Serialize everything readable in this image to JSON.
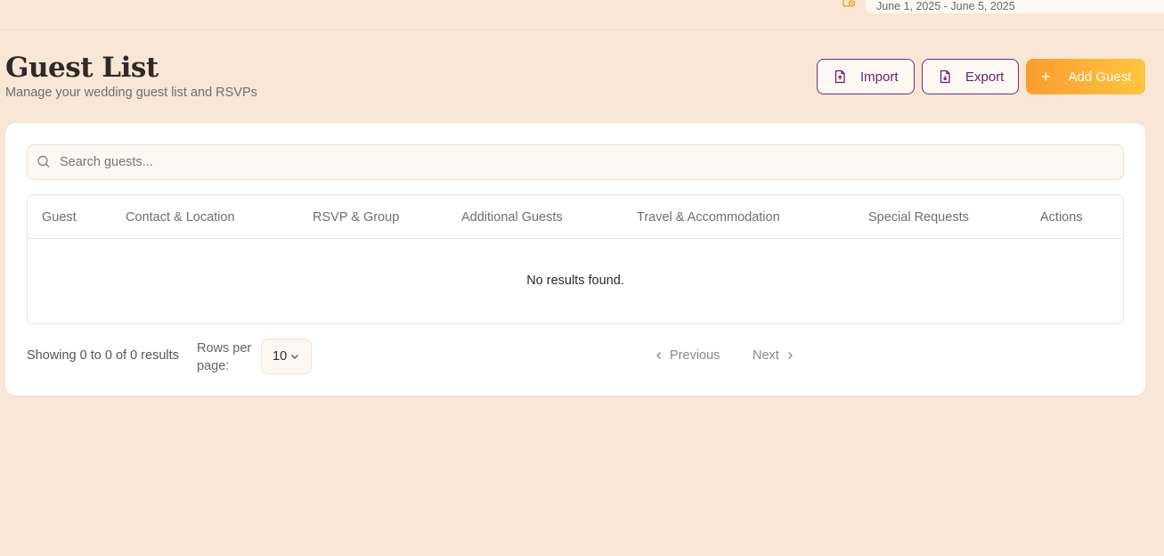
{
  "header": {
    "date_range": "June 1, 2025 - June 5, 2025",
    "calendar_icon": "calendar-icon"
  },
  "page": {
    "title": "Guest List",
    "subtitle": "Manage your wedding guest list and RSVPs"
  },
  "actions": {
    "import_label": "Import",
    "export_label": "Export",
    "add_label": "Add Guest"
  },
  "search": {
    "placeholder": "Search guests...",
    "value": ""
  },
  "table": {
    "columns": [
      "Guest",
      "Contact & Location",
      "RSVP & Group",
      "Additional Guests",
      "Travel & Accommodation",
      "Special Requests",
      "Actions"
    ],
    "empty_message": "No results found."
  },
  "pagination": {
    "showing_text": "Showing 0 to 0 of 0 results",
    "rows_per_page_label": "Rows per page:",
    "rows_per_page_value": "10",
    "previous_label": "Previous",
    "next_label": "Next"
  },
  "colors": {
    "background": "#f8e7d6",
    "accent_purple": "#6b1f76",
    "accent_orange_start": "#fb9d2d",
    "accent_orange_end": "#fec63f"
  }
}
